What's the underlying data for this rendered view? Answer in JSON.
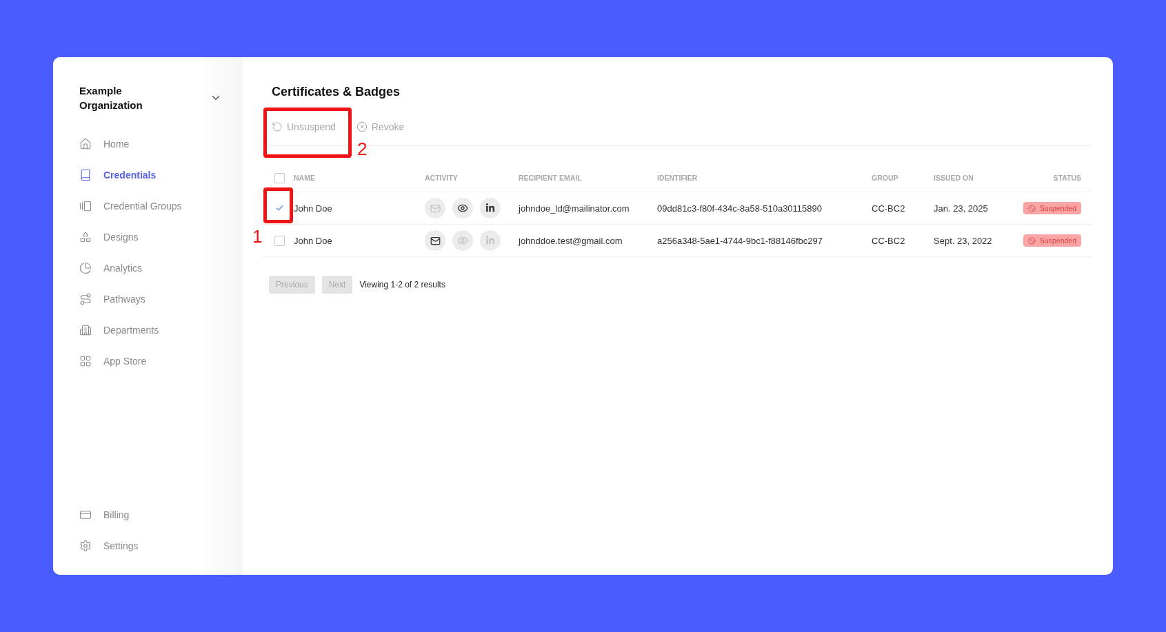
{
  "sidebar": {
    "organization": "Example\nOrganization",
    "items": [
      {
        "label": "Home",
        "selected": false
      },
      {
        "label": "Credentials",
        "selected": true
      },
      {
        "label": "Credential Groups",
        "selected": false
      },
      {
        "label": "Designs",
        "selected": false
      },
      {
        "label": "Analytics",
        "selected": false
      },
      {
        "label": "Pathways",
        "selected": false
      },
      {
        "label": "Departments",
        "selected": false
      },
      {
        "label": "App Store",
        "selected": false
      }
    ],
    "bottom_items": [
      {
        "label": "Billing",
        "selected": false
      },
      {
        "label": "Settings",
        "selected": false
      }
    ]
  },
  "page_title": "Certificates & Badges",
  "toolbar": [
    {
      "label": "Unsuspend",
      "disabled": true
    },
    {
      "label": "Revoke",
      "disabled": true
    }
  ],
  "table": {
    "select_all": {
      "checked": false
    },
    "columns": [
      "NAME",
      "ACTIVITY",
      "RECIPIENT EMAIL",
      "IDENTIFIER",
      "GROUP",
      "ISSUED ON",
      "STATUS"
    ],
    "rows": [
      {
        "checked": true,
        "name": "John Doe",
        "activity": [
          {
            "kind": "mail",
            "active": false
          },
          {
            "kind": "eye",
            "active": true
          },
          {
            "kind": "linkedin",
            "active": true
          }
        ],
        "email": "johndoe_ld@mailinator.com",
        "identifier": "09dd81c3-f80f-434c-8a58-510a30115890",
        "group": "CC-BC2",
        "issued_on": "Jan. 23, 2025",
        "status": "Suspended"
      },
      {
        "checked": false,
        "name": "John Doe",
        "activity": [
          {
            "kind": "mail",
            "active": true
          },
          {
            "kind": "eye",
            "active": false
          },
          {
            "kind": "linkedin",
            "active": false
          }
        ],
        "email": "johnddoe.test@gmail.com",
        "identifier": "a256a348-5ae1-4744-9bc1-f88146fbc297",
        "group": "CC-BC2",
        "issued_on": "Sept. 23, 2022",
        "status": "Suspended"
      }
    ]
  },
  "pagination": {
    "previous": {
      "label": "Previous",
      "disabled": true
    },
    "next": {
      "label": "Next",
      "disabled": true
    },
    "summary": "Viewing 1-2 of 2 results"
  },
  "annotations": [
    {
      "label": "1"
    },
    {
      "label": "2"
    }
  ]
}
